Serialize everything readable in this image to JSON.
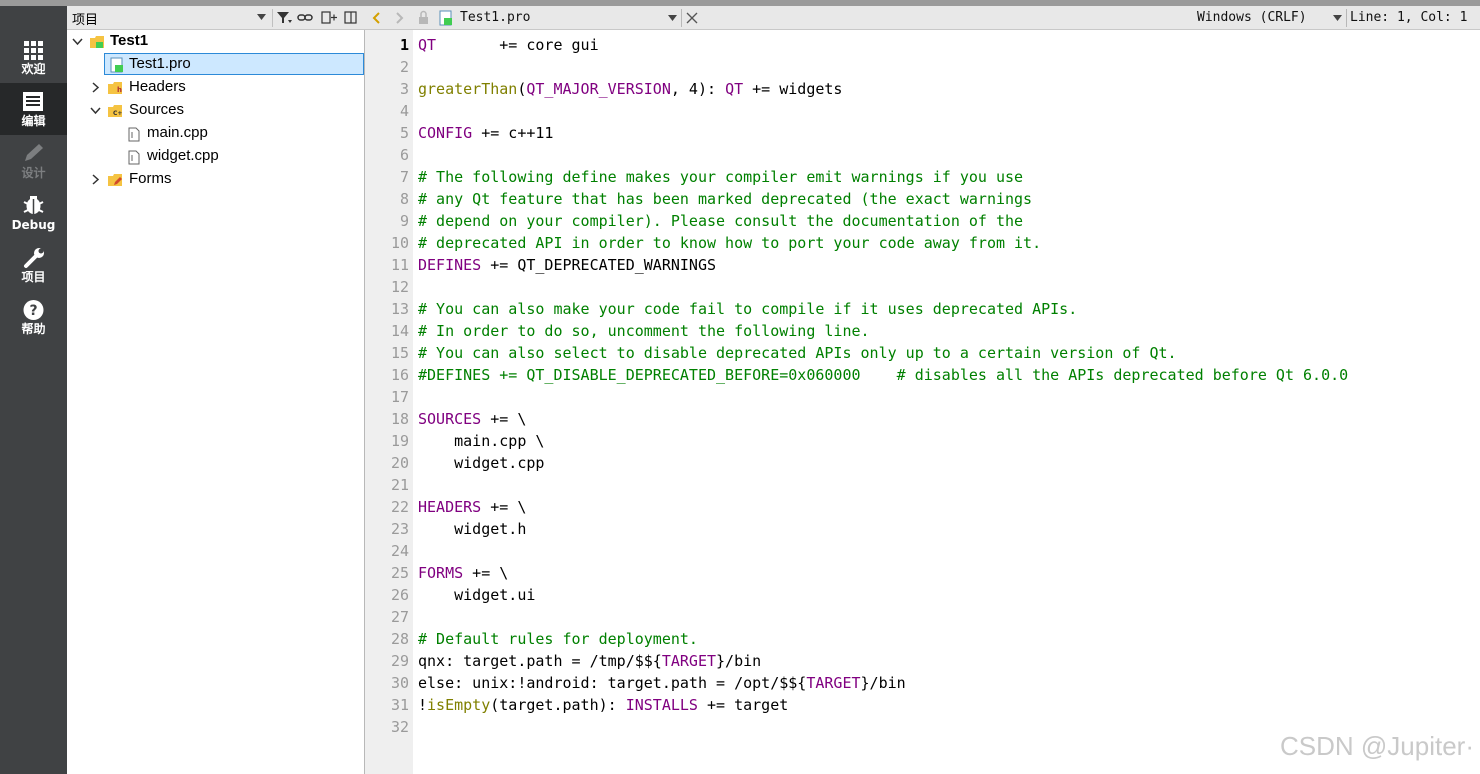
{
  "colors": {
    "keyword": "#800080",
    "function": "#808000",
    "comment": "#008000",
    "plain": "#000000",
    "selection": "#cde8ff",
    "modebar": "#404244"
  },
  "modes": [
    {
      "label": "欢迎",
      "icon": "grid-icon",
      "state": "normal"
    },
    {
      "label": "编辑",
      "icon": "edit-document-icon",
      "state": "active"
    },
    {
      "label": "设计",
      "icon": "pencil-icon",
      "state": "disabled"
    },
    {
      "label": "Debug",
      "icon": "bug-icon",
      "state": "normal"
    },
    {
      "label": "项目",
      "icon": "wrench-icon",
      "state": "normal"
    },
    {
      "label": "帮助",
      "icon": "help-icon",
      "state": "normal"
    }
  ],
  "project_panel": {
    "title": "项目",
    "tree": [
      {
        "label": "Test1",
        "icon": "qt-project-folder-icon",
        "expanded": true
      },
      {
        "label": "Test1.pro",
        "icon": "qt-pro-file-icon",
        "selected": true
      },
      {
        "label": "Headers",
        "icon": "headers-folder-icon",
        "expanded": false
      },
      {
        "label": "Sources",
        "icon": "sources-folder-icon",
        "expanded": true
      },
      {
        "label": "main.cpp",
        "icon": "cpp-file-icon"
      },
      {
        "label": "widget.cpp",
        "icon": "cpp-file-icon"
      },
      {
        "label": "Forms",
        "icon": "forms-folder-icon",
        "expanded": false
      }
    ]
  },
  "editor_toolbar": {
    "file_name": "Test1.pro",
    "encoding": "Windows (CRLF)",
    "position": "Line: 1, Col: 1"
  },
  "editor": {
    "current_line": 1,
    "lines": [
      [
        [
          "kw",
          "QT"
        ],
        [
          "pl",
          "       += core gui"
        ]
      ],
      [],
      [
        [
          "fn",
          "greaterThan"
        ],
        [
          "pl",
          "("
        ],
        [
          "kw",
          "QT_MAJOR_VERSION"
        ],
        [
          "pl",
          ", 4): "
        ],
        [
          "kw",
          "QT"
        ],
        [
          "pl",
          " += widgets"
        ]
      ],
      [],
      [
        [
          "kw",
          "CONFIG"
        ],
        [
          "pl",
          " += c++11"
        ]
      ],
      [],
      [
        [
          "cm",
          "# The following define makes your compiler emit warnings if you use"
        ]
      ],
      [
        [
          "cm",
          "# any Qt feature that has been marked deprecated (the exact warnings"
        ]
      ],
      [
        [
          "cm",
          "# depend on your compiler). Please consult the documentation of the"
        ]
      ],
      [
        [
          "cm",
          "# deprecated API in order to know how to port your code away from it."
        ]
      ],
      [
        [
          "kw",
          "DEFINES"
        ],
        [
          "pl",
          " += QT_DEPRECATED_WARNINGS"
        ]
      ],
      [],
      [
        [
          "cm",
          "# You can also make your code fail to compile if it uses deprecated APIs."
        ]
      ],
      [
        [
          "cm",
          "# In order to do so, uncomment the following line."
        ]
      ],
      [
        [
          "cm",
          "# You can also select to disable deprecated APIs only up to a certain version of Qt."
        ]
      ],
      [
        [
          "cm",
          "#DEFINES += QT_DISABLE_DEPRECATED_BEFORE=0x060000    # disables all the APIs deprecated before Qt 6.0.0"
        ]
      ],
      [],
      [
        [
          "kw",
          "SOURCES"
        ],
        [
          "pl",
          " += \\"
        ]
      ],
      [
        [
          "pl",
          "    main.cpp \\"
        ]
      ],
      [
        [
          "pl",
          "    widget.cpp"
        ]
      ],
      [],
      [
        [
          "kw",
          "HEADERS"
        ],
        [
          "pl",
          " += \\"
        ]
      ],
      [
        [
          "pl",
          "    widget.h"
        ]
      ],
      [],
      [
        [
          "kw",
          "FORMS"
        ],
        [
          "pl",
          " += \\"
        ]
      ],
      [
        [
          "pl",
          "    widget.ui"
        ]
      ],
      [],
      [
        [
          "cm",
          "# Default rules for deployment."
        ]
      ],
      [
        [
          "pl",
          "qnx: target.path = /tmp/$${"
        ],
        [
          "kw",
          "TARGET"
        ],
        [
          "pl",
          "}/bin"
        ]
      ],
      [
        [
          "pl",
          "else: unix:!android: target.path = /opt/$${"
        ],
        [
          "kw",
          "TARGET"
        ],
        [
          "pl",
          "}/bin"
        ]
      ],
      [
        [
          "pl",
          "!"
        ],
        [
          "fn",
          "isEmpty"
        ],
        [
          "pl",
          "(target.path): "
        ],
        [
          "kw",
          "INSTALLS"
        ],
        [
          "pl",
          " += target"
        ]
      ],
      []
    ]
  },
  "watermark": "CSDN @Jupiter·"
}
